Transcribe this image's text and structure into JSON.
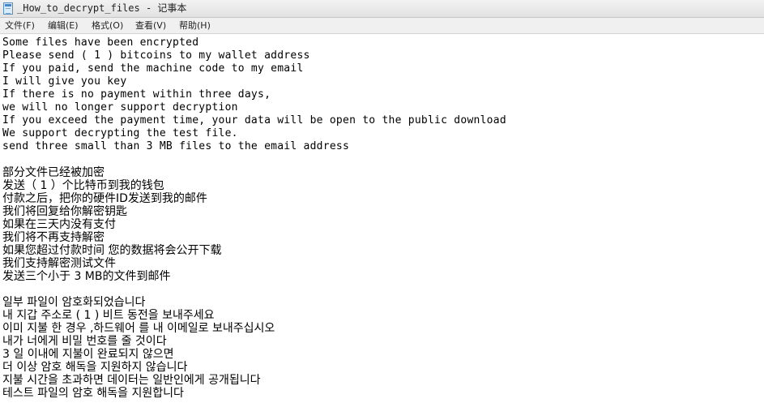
{
  "window": {
    "title": "_How_to_decrypt_files - 记事本",
    "icon": "notepad-icon"
  },
  "menu": {
    "file": "文件(F)",
    "edit": "编辑(E)",
    "format": "格式(O)",
    "view": "查看(V)",
    "help": "帮助(H)"
  },
  "document": {
    "lines": [
      "Some files have been encrypted",
      "Please send ( 1 ) bitcoins to my wallet address",
      "If you paid, send the machine code to my email",
      "I will give you key",
      "If there is no payment within three days,",
      "we will no longer support decryption",
      "If you exceed the payment time, your data will be open to the public download",
      "We support decrypting the test file.",
      "send three small than 3 MB files to the email address",
      "",
      "部分文件已经被加密",
      "发送（ 1 ）个比特币到我的钱包",
      "付款之后，把你的硬件ID发送到我的邮件",
      "我们将回复给你解密钥匙",
      "如果在三天内没有支付",
      "我们将不再支持解密",
      "如果您超过付款时间 您的数据将会公开下载",
      "我们支持解密测试文件",
      "发送三个小于 3 MB的文件到邮件",
      "",
      "일부 파일이 암호화되었습니다",
      "내 지갑 주소로 ( 1 ) 비트 동전을 보내주세요",
      "이미 지불 한 경우 ,하드웨어 를 내 이메일로 보내주십시오",
      "내가 너에게 비밀 번호를 줄 것이다",
      "3 일 이내에 지불이 완료되지 않으면",
      "더 이상 암호 해독을 지원하지 않습니다",
      "지불 시간을 초과하면 데이터는 일반인에게 공개됩니다",
      "테스트 파일의 암호 해독을 지원합니다"
    ]
  }
}
